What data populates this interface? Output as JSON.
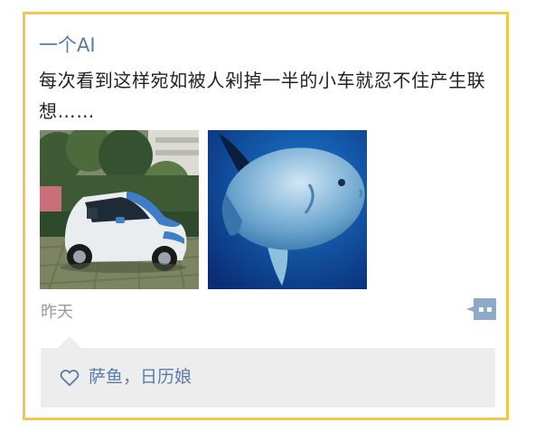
{
  "post": {
    "author": "一个AI",
    "text": "每次看到这样宛如被人剁掉一半的小车就忍不住产生联想……",
    "photos": [
      {
        "subject": "photo-car"
      },
      {
        "subject": "photo-sunfish"
      }
    ],
    "time": "昨天"
  },
  "actions": {
    "comment_icon": "comment-icon"
  },
  "likes": {
    "icon": "heart-icon",
    "names": "萨鱼，日历娘"
  },
  "colors": {
    "frame_border": "#F5C748",
    "name_link": "#5B7CA8",
    "timestamp": "#9A9A9A",
    "likes_bg": "#EDEDED"
  }
}
